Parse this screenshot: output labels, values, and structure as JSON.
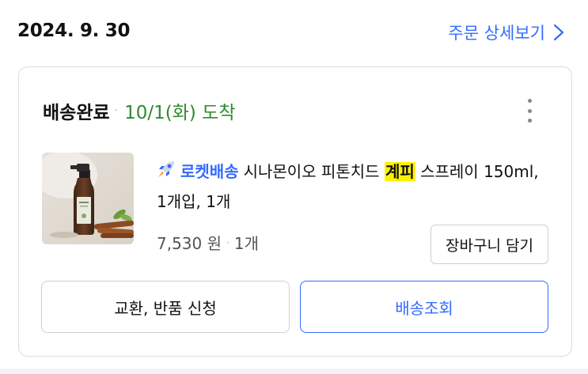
{
  "order": {
    "date": "2024. 9. 30",
    "detail_link": "주문 상세보기"
  },
  "shipment": {
    "status": "배송완료",
    "separator": "·",
    "arrival": "10/1(화) 도착",
    "more_icon": "more-vertical-icon"
  },
  "product": {
    "thumbnail_icon": "product-spray-bottle-image",
    "rocket_icon": "rocket-icon",
    "rocket_label": "로켓배송",
    "name_before": "시나몬이오 피톤치드 ",
    "name_highlight": "계피",
    "name_after": " 스프레이 150ml, 1개입, 1개",
    "price": "7,530 원",
    "separator": "·",
    "quantity": "1개",
    "cart_button": "장바구니 담기"
  },
  "actions": {
    "return_button": "교환, 반품 신청",
    "tracking_button": "배송조회"
  },
  "colors": {
    "accent_blue": "#346aff",
    "delivered_green": "#2e8b2e",
    "highlight_yellow": "#fff200"
  }
}
